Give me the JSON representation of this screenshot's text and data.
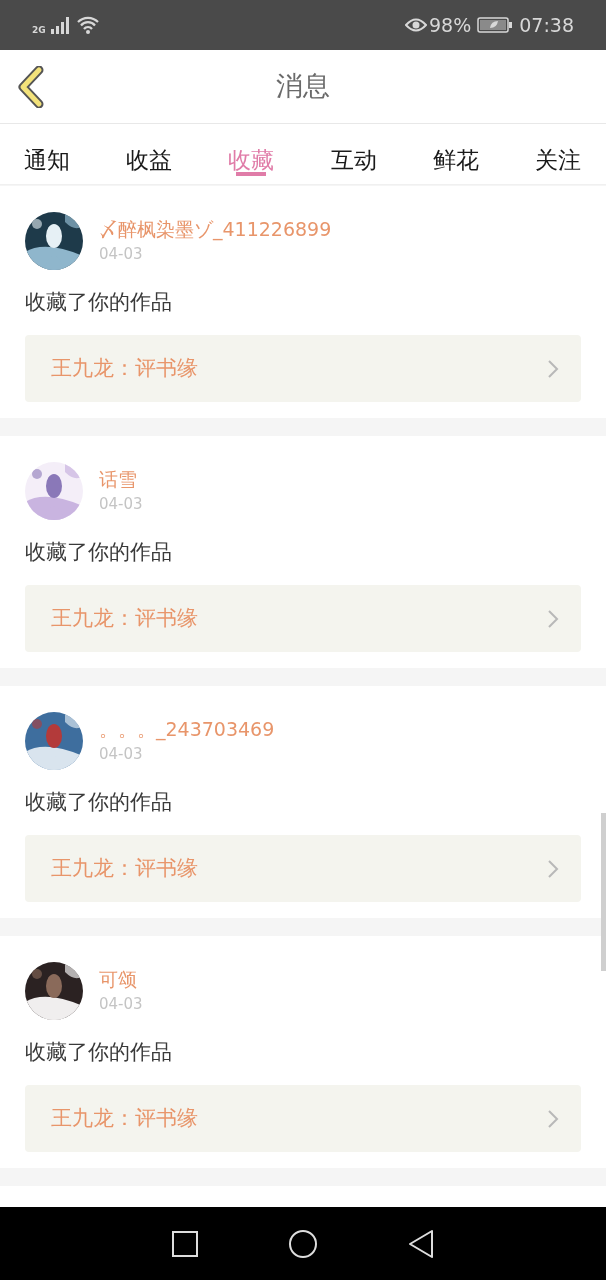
{
  "status_bar": {
    "network": "2G",
    "battery": "98%",
    "time": "07:38"
  },
  "header": {
    "title": "消息"
  },
  "tabs": [
    {
      "label": "通知",
      "selected": false
    },
    {
      "label": "收益",
      "selected": false
    },
    {
      "label": "收藏",
      "selected": true
    },
    {
      "label": "互动",
      "selected": false
    },
    {
      "label": "鲜花",
      "selected": false
    },
    {
      "label": "关注",
      "selected": false
    }
  ],
  "messages": [
    {
      "user": "〆醉枫染墨ゾ_411226899",
      "date": "04-03",
      "text": "收藏了你的作品",
      "work": "王九龙：评书缘"
    },
    {
      "user": "话雪",
      "date": "04-03",
      "text": "收藏了你的作品",
      "work": "王九龙：评书缘"
    },
    {
      "user": "。。。_243703469",
      "date": "04-03",
      "text": "收藏了你的作品",
      "work": "王九龙：评书缘"
    },
    {
      "user": "可颂",
      "date": "04-03",
      "text": "收藏了你的作品",
      "work": "王九龙：评书缘"
    }
  ]
}
